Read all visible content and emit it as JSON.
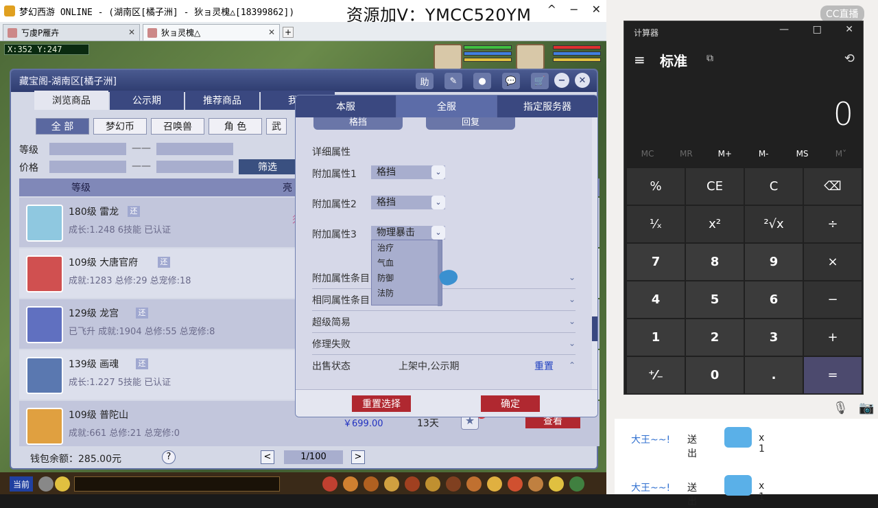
{
  "game_window": {
    "title": "梦幻西游 ONLINE - (湖南区[橘子洲] - 狄ョ灵槐△[18399862])",
    "watermark": "资源加V：YMCC520YM",
    "ctrl_min": "^",
    "ctrl_restore": "−",
    "ctrl_close": "✕",
    "tabs": [
      {
        "label": "丂虔P雁卉"
      },
      {
        "label": "狄ョ灵槐△"
      }
    ],
    "tab_close": "✕",
    "tab_add": "+",
    "coords": "X:352 Y:247"
  },
  "cbg": {
    "title": "藏宝阁-湖南区[橘子洲]",
    "header_icons": {
      "help": "助",
      "edit": "✎",
      "record": "●",
      "chat": "💬",
      "cart": "🛒",
      "minimize": "−",
      "close": "✕"
    },
    "main_tabs": [
      "浏览商品",
      "公示期",
      "推荐商品",
      "我是"
    ],
    "categories": [
      "全 部",
      "梦幻币",
      "召唤兽",
      "角 色",
      "武"
    ],
    "level_label": "等级",
    "price_label": "价格",
    "range_dash": "——",
    "filter_button": "筛选",
    "list_header": {
      "level": "等级",
      "col2": "亮"
    },
    "tag": "还",
    "rows": [
      {
        "name": "180级 雷龙",
        "sub": "成长:1.248  6技能  已认证",
        "side": "须"
      },
      {
        "name": "109级 大唐官府",
        "sub": "成就:1283  总修:29  总宠修:18"
      },
      {
        "name": "129级 龙宫",
        "sub": "已飞升  成就:1904  总修:55  总宠修:8"
      },
      {
        "name": "139级 画魂",
        "sub": "成长:1.227  5技能  已认证"
      },
      {
        "name": "109级 普陀山",
        "sub": "成就:661  总修:21  总宠修:0",
        "price": "￥699.00",
        "days": "13天",
        "star": "★",
        "badge": "2",
        "view": "查看"
      }
    ],
    "wallet": "钱包余额：285.00元",
    "help": "?",
    "page_prev": "<",
    "page": "1/100",
    "page_next": ">"
  },
  "popup": {
    "tabs": [
      "本服",
      "全服",
      "指定服务器"
    ],
    "top_buttons": [
      "格挡",
      "回复"
    ],
    "detail_title": "详细属性",
    "attrs": [
      {
        "label": "附加属性1",
        "value": "格挡"
      },
      {
        "label": "附加属性2",
        "value": "格挡"
      },
      {
        "label": "附加属性3",
        "value": "物理暴击"
      }
    ],
    "chevron": "⌄",
    "dropdown_options": [
      "治疗",
      "气血",
      "防御",
      "法防"
    ],
    "collapsibles": [
      {
        "label": "附加属性条目"
      },
      {
        "label": "相同属性条目"
      },
      {
        "label": "超级简易"
      },
      {
        "label": "修理失败"
      }
    ],
    "sale_status": {
      "label": "出售状态",
      "value": "上架中,公示期",
      "reset": "重置",
      "chevron": "⌃"
    },
    "reset_button": "重置选择",
    "confirm_button": "确定"
  },
  "taskbar": {
    "now": "当前"
  },
  "stream": {
    "cc_logo": "CC直播",
    "chat": [
      {
        "who": "大王~~!",
        "act": "送出",
        "count": "x 1"
      },
      {
        "who": "大王~~!",
        "act": "送出",
        "count": "x 1"
      }
    ],
    "mic": "🎙",
    "cam": "📷"
  },
  "calculator": {
    "title": "计算器",
    "ctrl_min": "—",
    "ctrl_max": "□",
    "ctrl_close": "✕",
    "menu": "≡",
    "mode": "标准",
    "keep_on_top": "⧉",
    "history": "⟲",
    "display": "0",
    "memory": [
      "MC",
      "MR",
      "M+",
      "M-",
      "MS",
      "M˅"
    ],
    "keys": [
      "%",
      "CE",
      "C",
      "⌫",
      "¹⁄ₓ",
      "x²",
      "²√x",
      "÷",
      "7",
      "8",
      "9",
      "×",
      "4",
      "5",
      "6",
      "−",
      "1",
      "2",
      "3",
      "+",
      "⁺⁄₋",
      "0",
      ".",
      "="
    ]
  }
}
